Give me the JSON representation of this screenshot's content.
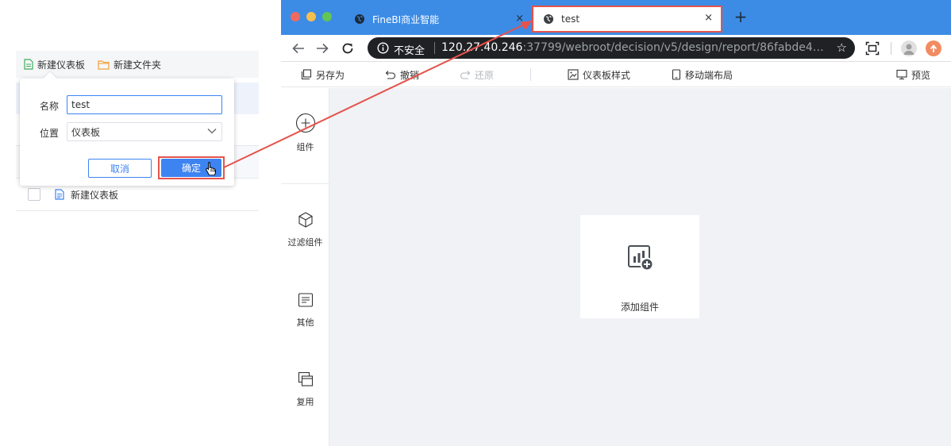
{
  "left_panel": {
    "toolbar": {
      "new_dashboard": "新建仪表板",
      "new_folder": "新建文件夹"
    },
    "list_item_label": "新建仪表板"
  },
  "dialog": {
    "name_label": "名称",
    "name_value": "test",
    "location_label": "位置",
    "location_value": "仪表板",
    "cancel_label": "取消",
    "confirm_label": "确定"
  },
  "browser": {
    "tabs": [
      {
        "title": "FineBI商业智能",
        "close": "×"
      },
      {
        "title": "test",
        "close": "×"
      }
    ],
    "new_tab": "+",
    "address": {
      "security_label": "不安全",
      "url_host": "120.27.40.246",
      "url_rest": ":37799/webroot/decision/v5/design/report/86fabde4046...",
      "star": "☆"
    }
  },
  "toolbar": {
    "save_as": "另存为",
    "undo": "撤销",
    "redo": "还原",
    "dashboard_style": "仪表板样式",
    "mobile_layout": "移动端布局",
    "preview": "预览"
  },
  "sidebar": {
    "items": [
      {
        "label": "组件",
        "icon": "plus-circle-icon"
      },
      {
        "label": "过滤组件",
        "icon": "cube-icon"
      },
      {
        "label": "其他",
        "icon": "note-icon"
      },
      {
        "label": "复用",
        "icon": "layers-icon"
      }
    ]
  },
  "canvas": {
    "add_component_label": "添加组件"
  },
  "colors": {
    "tab_bar": "#3c8ce6",
    "primary": "#3d84f2",
    "highlight_red": "#e5534b",
    "canvas_bg": "#f0f2f5"
  }
}
